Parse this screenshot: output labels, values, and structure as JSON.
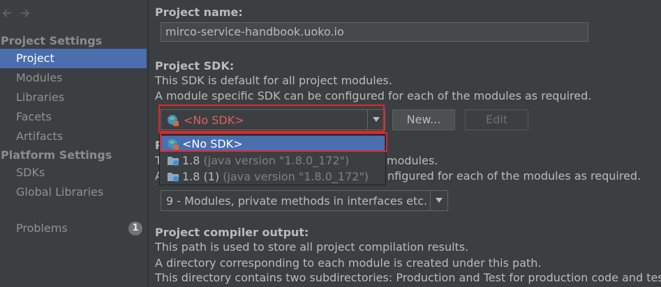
{
  "sidebar": {
    "project_settings_header": "Project Settings",
    "platform_settings_header": "Platform Settings",
    "items": [
      {
        "label": "Project"
      },
      {
        "label": "Modules"
      },
      {
        "label": "Libraries"
      },
      {
        "label": "Facets"
      },
      {
        "label": "Artifacts"
      },
      {
        "label": "SDKs"
      },
      {
        "label": "Global Libraries"
      },
      {
        "label": "Problems",
        "badge": "1"
      }
    ]
  },
  "main": {
    "project_name_label": "Project name:",
    "project_name_value": "mirco-service-handbook.uoko.io",
    "sdk_label": "Project SDK:",
    "sdk_desc_1": "This SDK is default for all project modules.",
    "sdk_desc_2": "A module specific SDK can be configured for each of the modules as required.",
    "sdk_selected": "<No SDK>",
    "new_button": "New...",
    "edit_button": "Edit",
    "sdk_dropdown": [
      {
        "name": "<No SDK>",
        "version": ""
      },
      {
        "name": "1.8",
        "version": "(java version \"1.8.0_172\")"
      },
      {
        "name": "1.8 (1)",
        "version": "(java version \"1.8.0_172\")"
      }
    ],
    "lang_label_partial": "P",
    "lang_desc_1_prefix": "T",
    "lang_desc_1_suffix": "modules.",
    "lang_desc_2_prefix": "A",
    "lang_desc_2_suffix": "nfigured for each of the modules as required.",
    "lang_level": "9 - Modules, private methods in interfaces etc.",
    "compiler_label": "Project compiler output:",
    "compiler_desc_1": "This path is used to store all project compilation results.",
    "compiler_desc_2": "A directory corresponding to each module is created under this path.",
    "compiler_desc_3": "This directory contains two subdirectories: Production and Test for production code and test so"
  },
  "colors": {
    "background": "#3c3f41",
    "selection": "#4b6eaf",
    "highlight_outline": "#e0272c",
    "no_sdk_text": "#e06161"
  },
  "icons": [
    "back-arrow-icon",
    "forward-arrow-icon",
    "sdk-globe-icon",
    "folder-jdk-icon",
    "chevron-down-icon"
  ]
}
